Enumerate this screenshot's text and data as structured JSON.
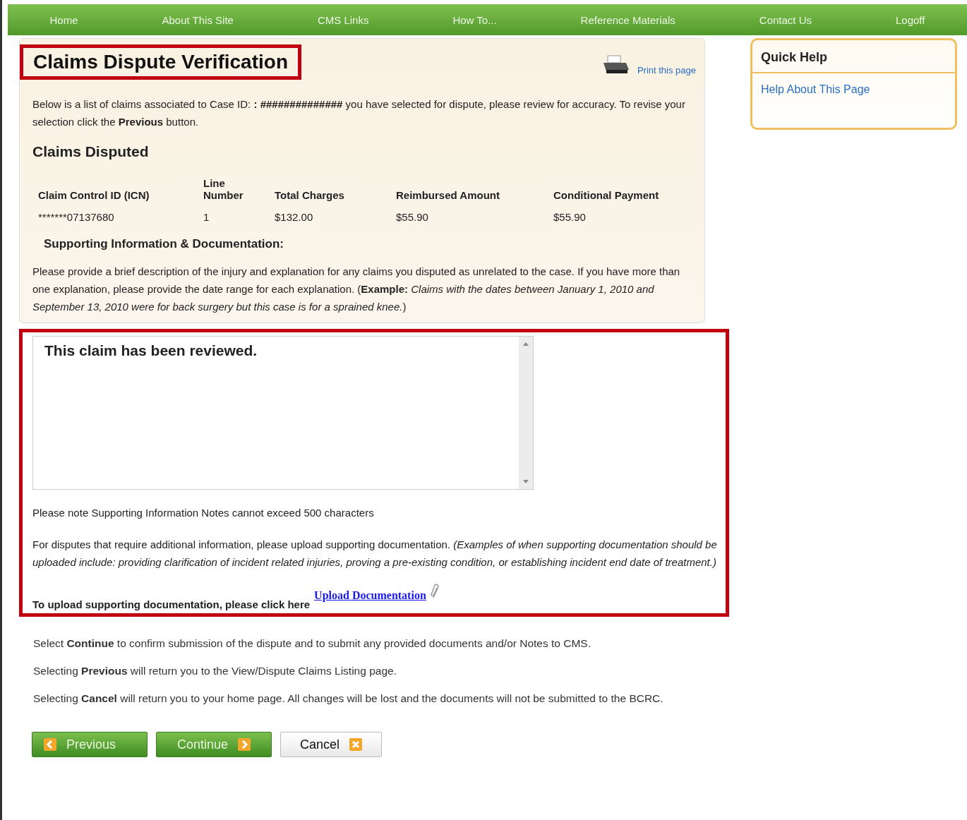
{
  "nav": [
    {
      "label": "Home"
    },
    {
      "label": "About This Site"
    },
    {
      "label": "CMS Links"
    },
    {
      "label": "How To..."
    },
    {
      "label": "Reference Materials"
    },
    {
      "label": "Contact Us"
    },
    {
      "label": "Logoff"
    }
  ],
  "title": "Claims Dispute Verification",
  "print_link": "Print this page",
  "intro": "Below is a list of claims associated to Case ID: **: ##############**  you have selected for dispute, please review for accuracy. To revise your selection click the **Previous** button.",
  "section_title": "Claims Disputed",
  "table": {
    "columns": [
      "Claim Control ID (ICN)",
      "Line Number",
      "Total Charges",
      "Reimbursed Amount",
      "Conditional Payment"
    ],
    "rows": [
      [
        "*******07137680",
        "1",
        "$132.00",
        "$55.90",
        "$55.90"
      ]
    ]
  },
  "supporting_title": "Supporting Information & Documentation:",
  "supporting_text": "Please provide a brief description of the injury and explanation for any claims you disputed as unrelated to the case. If you have more than one explanation, please provide the date range for each explanation. (**Example:** *Claims with the dates between January 1, 2010 and September 13, 2010 were for back surgery but this case is for a sprained knee.*)",
  "notes_value": "This claim has been reviewed.",
  "notes_limit": "Please note Supporting Information Notes cannot exceed 500 characters",
  "upload_text": "For disputes that require additional information, please upload supporting documentation. *(Examples of when supporting documentation should be uploaded include: providing clarification of incident related injuries, proving a pre-existing condition, or establishing incident end date of treatment.)*",
  "upload_prompt": "To upload supporting documentation, please click here",
  "upload_link": "Upload Documentation",
  "instructions": [
    "Select **Continue** to confirm submission of the dispute and to submit any provided documents and/or Notes to CMS.",
    "Selecting **Previous** will return you to the View/Dispute Claims Listing page.",
    "Selecting **Cancel** will return you to your home page. All changes will be lost and the documents will not be submitted to the BCRC."
  ],
  "buttons": [
    {
      "label": "Previous",
      "kind": "previous"
    },
    {
      "label": "Continue",
      "kind": "continue"
    },
    {
      "label": "Cancel",
      "kind": "cancel"
    }
  ],
  "quick_help": {
    "title": "Quick Help",
    "link": "Help About This Page"
  }
}
